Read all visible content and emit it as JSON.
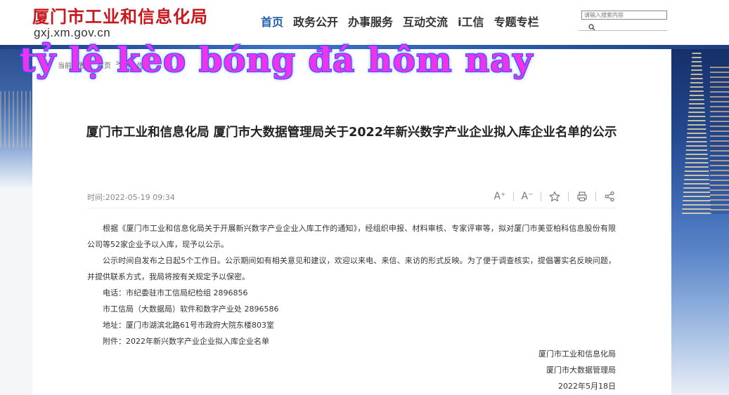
{
  "header": {
    "title": "厦门市工业和信息化局",
    "domain": "gxj.xm.gov.cn",
    "nav": [
      "首页",
      "政务公开",
      "办事服务",
      "互动交流",
      "i工信",
      "专题专栏"
    ],
    "search_placeholder": "请输入搜索内容"
  },
  "breadcrumb": [
    "当前位置：",
    "首页",
    ">",
    "中",
    "告"
  ],
  "overlay_text": "tỷ lệ kèo bóng đá hôm nay",
  "article": {
    "title": "厦门市工业和信息化局 厦门市大数据管理局关于2022年新兴数字产业企业拟入库企业名单的公示",
    "time": "时间:2022-05-19 09:34",
    "paragraphs": [
      "根据《厦门市工业和信息化局关于开展新兴数字产业企业入库工作的通知》，经组织申报、材料审核、专家评审等，拟对厦门市美亚柏科信息股份有限公司等52家企业予以入库，现予以公示。",
      "公示时间自发布之日起5个工作日。公示期间如有相关意见和建议，欢迎以来电、来信、来访的形式反映。为了便于调查核实，提倡署实名反映问题，并提供联系方式，我局将按有关规定予以保密。"
    ],
    "lines": [
      "电话：市纪委驻市工信局纪检组 2896856",
      "市工信局（大数据局）软件和数字产业处 2896586",
      "地址：厦门市湖滨北路61号市政府大院东楼803室",
      "附件：2022年新兴数字产业企业拟入库企业名单"
    ],
    "signature": [
      "厦门市工业和信息化局",
      "厦门市大数据管理局",
      "2022年5月18日"
    ]
  },
  "tools": {
    "font_larger": "A⁺",
    "font_smaller": "A⁻"
  }
}
